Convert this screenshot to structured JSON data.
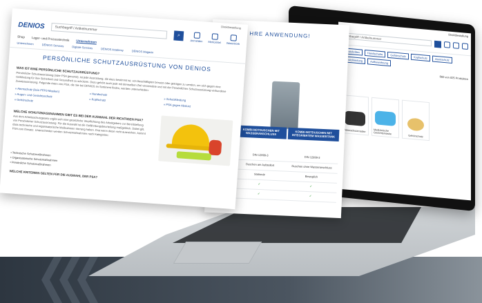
{
  "front": {
    "toplink": "Direktbestellung",
    "logo": "DENIOS",
    "search_placeholder": "Suchbegriff / Artikelnummer",
    "icons": [
      {
        "label": "Anmelden"
      },
      {
        "label": "Merkzettel"
      },
      {
        "label": "Warenkorb"
      }
    ],
    "nav": [
      "Shop",
      "Lager- und Prozesstechnik",
      "Unternehmen"
    ],
    "sub_nav": [
      "Unternehmen",
      "DENIOS Services",
      "Digitale Services",
      "DENIOS Academy",
      "DENIOS Magazin"
    ],
    "title": "PERSÖNLICHE SCHUTZAUSRÜSTUNG VON DENIOS",
    "h1": "WAS IST EINE PERSÖNLICHE SCHUTZAUSRÜSTUNG?",
    "p1": "Persönliche Schutzausrüstung (oder PSA genannt), ist jede Ausrüstung, die dazu bestimmt ist, von Beschäftigten benutzt oder getragen zu werden, um sich gegen eine Gefährdung für ihre Sicherheit und Gesundheit zu schützen. Dazu gehört auch jede mit demselben Ziel verwendete und mit der Persönlichen Schutzausrüstung verbundene Zusatzausrüstung. Folgende Arten von PSA, die Sie bei DENIOS im Sortiment finden, werden unterschieden:",
    "links": [
      "Atemschutz (kein FFP3-Masken)",
      "Handschutz",
      "Schutzkleidung",
      "Augen- und Gesichtsschutz",
      "Kopfschutz",
      "Gehörschutz",
      "PSA gegen Absturz"
    ],
    "h2": "WELCHE SCHUTZMASSNAHMEN GIBT ES BEI DER AUSWAHL DER RICHTIGEN PSA?",
    "p2": "Aus dem Arbeitsschutzgesetz ergibt sich eine gesetzliche Verpflichtung des Arbeitgebers zur Bereitstellung von Persönlicher Schutzausrüstung. Für die Auswahl ist die Gefährdungsbeurteilung maßgeblich. Dabei gilt, dass technische und organisatorische Maßnahmen Vorrang haben. Erst wenn diese nicht ausreichen, kommt PSA zum Einsatz. Unterschieden werden Schutzmaßnahmen nach Kategorien:",
    "bullets": [
      "Technische Schutzmaßnahmen",
      "Organisatorische Schutzmaßnahmen",
      "Persönliche Schutzmaßnahmen"
    ],
    "bottom": "WELCHE KRITERIEN GELTEN FÜR DIE AUSWAHL DER PSA?"
  },
  "middle": {
    "heading": "HRE ANWENDUNG!",
    "col1": "KOMBI-NOTDUSCHEN MIT WASSERANSCHLUSS",
    "col2": "KOMBI-NOTDUSCHEN MIT INTEGRIERTEM WASSERTANK",
    "rows": [
      [
        "DIN 12899-3",
        "DIN 12899-3"
      ],
      [
        "Duschen am Aufstellort",
        "Duschen ohne Wasseranschluss"
      ],
      [
        "Stationär",
        "Beweglich"
      ],
      [
        "✓",
        "✓"
      ],
      [
        "✓",
        "✓"
      ]
    ]
  },
  "laptop": {
    "search": "Suchbegriff / Artikelnummer",
    "toplink": "Direktbestellung",
    "tabs": [
      "Schutzbrillen",
      "Handschuhe",
      "Gehörschutz",
      "Kopfschutz",
      "Atemschutz",
      "Schutzkleidung",
      "Aufbewahrung"
    ],
    "count": "660 von 825 Produkten",
    "products": [
      "Atemschutzmaske",
      "Medizinische Gesichtsmaske",
      "Gehörschutz"
    ]
  },
  "colors": {
    "brand": "#1f4f9c",
    "helmet": "#f3c20d",
    "band": "#2d3640"
  }
}
